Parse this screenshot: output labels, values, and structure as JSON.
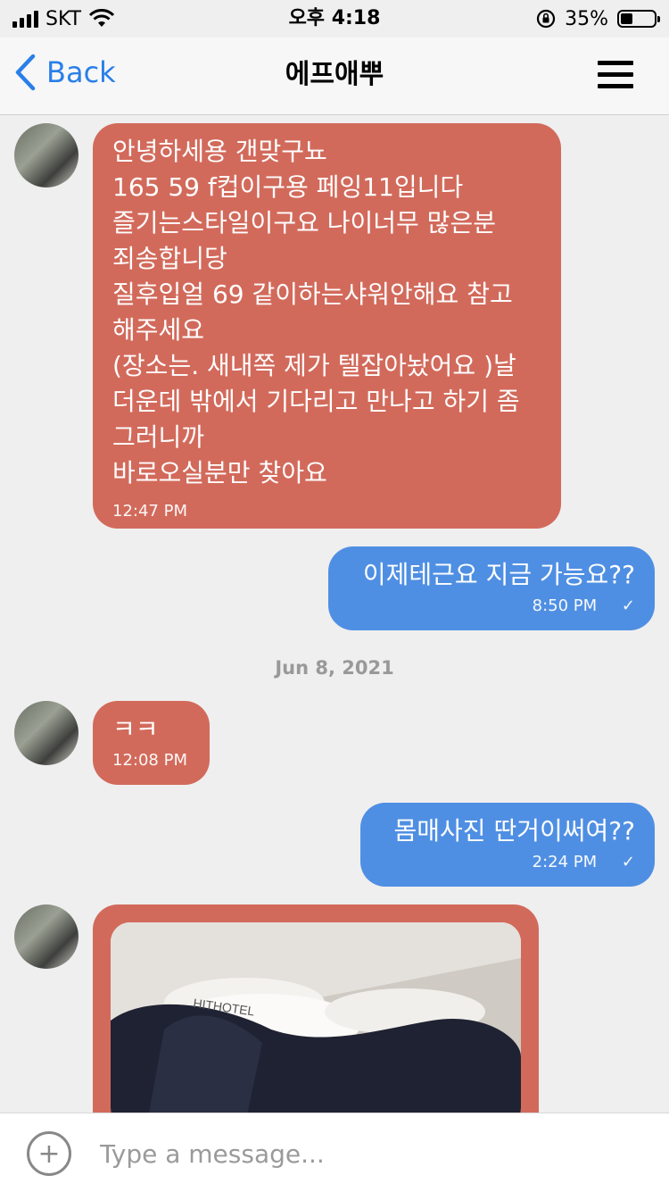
{
  "status_bar": {
    "carrier": "SKT",
    "time": "오후 4:18",
    "battery_text": "35%",
    "battery_level": 0.35
  },
  "nav": {
    "back_label": "Back",
    "title": "에프애뿌"
  },
  "messages": [
    {
      "direction": "in",
      "text": "안녕하세용 갠맞구뇨\n165 59 f컵이구용 페잉11입니다\n즐기는스타일이구요 나이너무 많은분\n죄송합니당\n질후입얼 69 같이하는샤워안해요 참고\n해주세요\n(장소는. 새내쪽 제가 텔잡아놨어요 )날\n더운데 밖에서 기다리고 만나고 하기 좀\n그러니까\n바로오실분만 찾아요",
      "time": "12:47 PM"
    },
    {
      "direction": "out",
      "text": "이제테근요 지금 가능요??",
      "time": "8:50 PM",
      "check": "✓"
    },
    {
      "direction": "in",
      "text": "ㅋㅋ",
      "time": "12:08 PM"
    },
    {
      "direction": "out",
      "text": "몸매사진 딴거이써여??",
      "time": "2:24 PM",
      "check": "✓"
    }
  ],
  "date_separator": "Jun 8, 2021",
  "photo": {
    "pillow_label": "HITHOTEL"
  },
  "composer": {
    "add_icon": "plus-circle-icon",
    "placeholder": "Type a message..."
  },
  "colors": {
    "incoming_bubble": "#d26a5b",
    "outgoing_bubble": "#4f8fe3",
    "accent": "#2a7fe8"
  }
}
